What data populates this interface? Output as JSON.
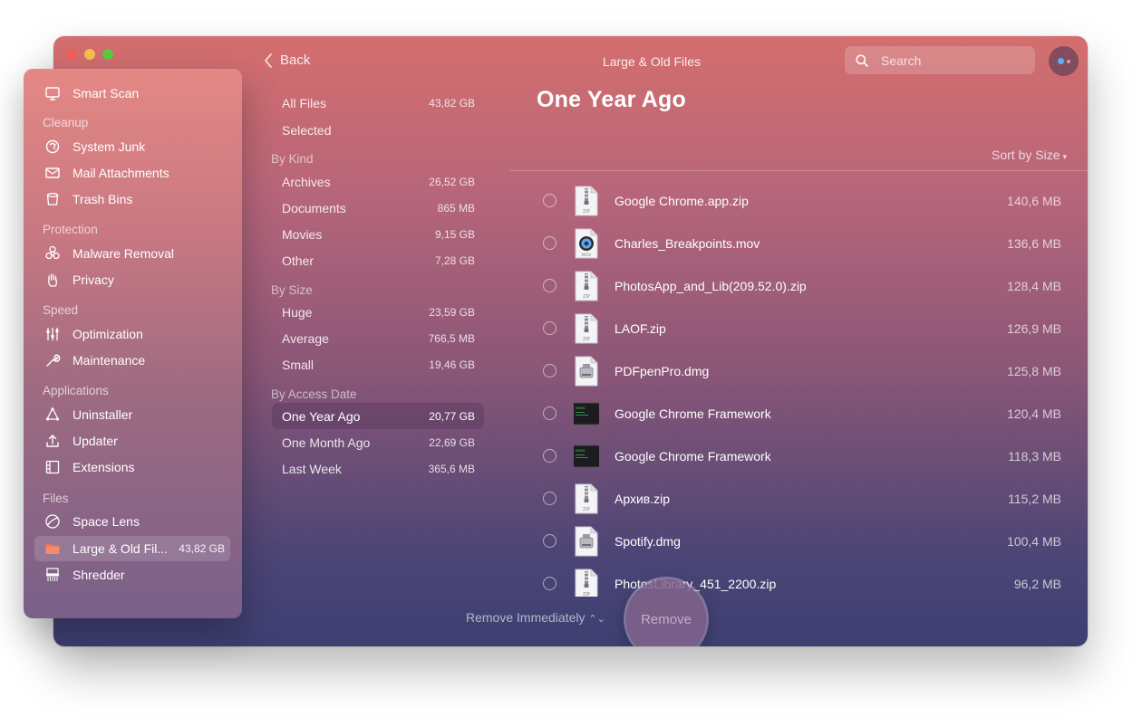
{
  "window": {
    "title": "Large & Old Files",
    "back_label": "Back",
    "search_placeholder": "Search"
  },
  "sidebar": {
    "items": [
      {
        "label": "Smart Scan",
        "icon": "monitor-icon"
      },
      {
        "label": "System Junk",
        "icon": "system-junk-icon"
      },
      {
        "label": "Mail Attachments",
        "icon": "envelope-icon"
      },
      {
        "label": "Trash Bins",
        "icon": "trash-icon"
      },
      {
        "label": "Malware Removal",
        "icon": "biohazard-icon"
      },
      {
        "label": "Privacy",
        "icon": "hand-icon"
      },
      {
        "label": "Optimization",
        "icon": "sliders-icon"
      },
      {
        "label": "Maintenance",
        "icon": "wrench-icon"
      },
      {
        "label": "Uninstaller",
        "icon": "uninstaller-icon"
      },
      {
        "label": "Updater",
        "icon": "updater-icon"
      },
      {
        "label": "Extensions",
        "icon": "extensions-icon"
      },
      {
        "label": "Space Lens",
        "icon": "space-lens-icon"
      },
      {
        "label": "Large & Old Fil...",
        "icon": "folder-icon",
        "size": "43,82 GB"
      },
      {
        "label": "Shredder",
        "icon": "shredder-icon"
      }
    ],
    "sections": [
      "Cleanup",
      "Protection",
      "Speed",
      "Applications",
      "Files"
    ]
  },
  "categories": {
    "top": [
      {
        "label": "All Files",
        "size": "43,82 GB"
      },
      {
        "label": "Selected",
        "size": ""
      }
    ],
    "by_kind": {
      "title": "By Kind",
      "items": [
        {
          "label": "Archives",
          "size": "26,52 GB"
        },
        {
          "label": "Documents",
          "size": "865 MB"
        },
        {
          "label": "Movies",
          "size": "9,15 GB"
        },
        {
          "label": "Other",
          "size": "7,28 GB"
        }
      ]
    },
    "by_size": {
      "title": "By Size",
      "items": [
        {
          "label": "Huge",
          "size": "23,59 GB"
        },
        {
          "label": "Average",
          "size": "766,5 MB"
        },
        {
          "label": "Small",
          "size": "19,46 GB"
        }
      ]
    },
    "by_access": {
      "title": "By Access Date",
      "items": [
        {
          "label": "One Year Ago",
          "size": "20,77 GB"
        },
        {
          "label": "One Month Ago",
          "size": "22,69 GB"
        },
        {
          "label": "Last Week",
          "size": "365,6 MB"
        }
      ]
    }
  },
  "main": {
    "heading": "One Year Ago",
    "sort_label": "Sort by Size",
    "files": [
      {
        "name": "Google Chrome.app.zip",
        "size": "140,6 MB",
        "icon": "zip-file-icon"
      },
      {
        "name": "Charles_Breakpoints.mov",
        "size": "136,6 MB",
        "icon": "movie-file-icon"
      },
      {
        "name": "PhotosApp_and_Lib(209.52.0).zip",
        "size": "128,4 MB",
        "icon": "zip-file-icon"
      },
      {
        "name": "LAOF.zip",
        "size": "126,9 MB",
        "icon": "zip-file-icon"
      },
      {
        "name": "PDFpenPro.dmg",
        "size": "125,8 MB",
        "icon": "disk-image-icon"
      },
      {
        "name": "Google Chrome Framework",
        "size": "120,4 MB",
        "icon": "exec-file-icon"
      },
      {
        "name": "Google Chrome Framework",
        "size": "118,3 MB",
        "icon": "exec-file-icon"
      },
      {
        "name": "Архив.zip",
        "size": "115,2 MB",
        "icon": "zip-file-icon"
      },
      {
        "name": "Spotify.dmg",
        "size": "100,4 MB",
        "icon": "disk-image-icon"
      },
      {
        "name": "PhotosLibrary_451_2200.zip",
        "size": "96,2 MB",
        "icon": "zip-file-icon"
      }
    ],
    "remove_mode_label": "Remove Immediately",
    "remove_button": "Remove"
  }
}
